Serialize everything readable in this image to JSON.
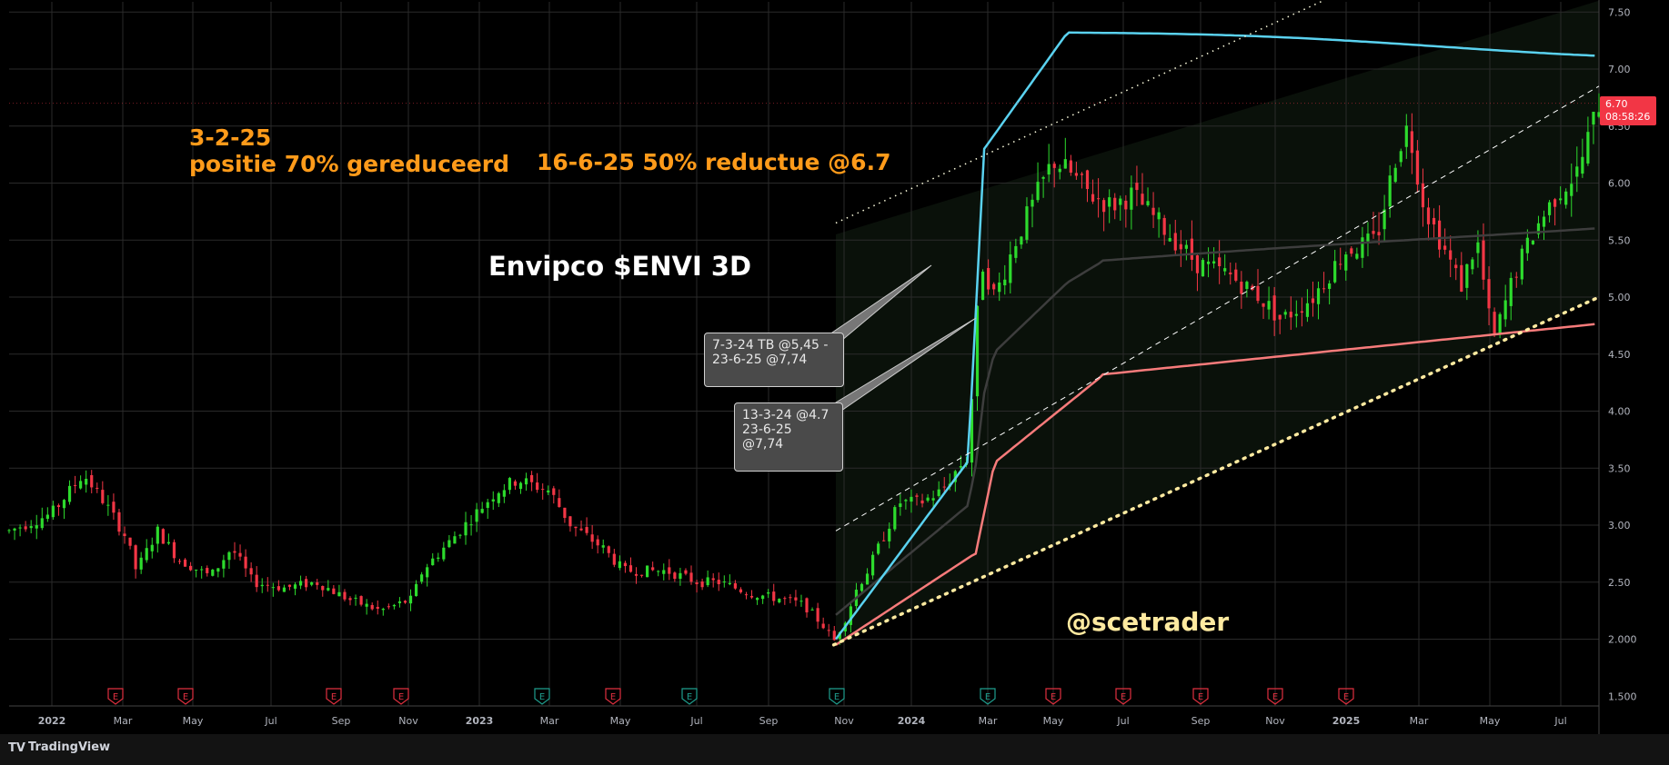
{
  "app": {
    "brand": "TradingView"
  },
  "annotations": {
    "note1_line1": "3-2-25",
    "note1_line2": "positie 70% gereduceerd",
    "note2": "16-6-25 50% reductue @6.7",
    "title": "Envipco $ENVI 3D",
    "watermark": "@scetrader",
    "callout1": "7-3-24 TB @5,45 -\n23-6-25 @7,74",
    "callout2": "13-3-24 @4.7\n23-6-25\n@7,74"
  },
  "price_tag": {
    "price": "6.70",
    "countdown": "08:58:26"
  },
  "colors": {
    "up": "#2ddb2d",
    "down": "#f23645",
    "upper_band": "#5ad2f0",
    "lower_band": "#f77b7b",
    "mid_band": "#3d3d3d",
    "channel_top": "#ffffe0",
    "channel_bottom": "#ffeaa0",
    "annotation": "#ff9b1a",
    "earnings_red": "#e0303f",
    "earnings_teal": "#1f9e8e"
  },
  "chart_data": {
    "type": "candlestick",
    "title": "Envipco $ENVI 3D",
    "ylim": [
      1.45,
      7.6
    ],
    "y_ticks": [
      "7.50",
      "7.00",
      "6.50",
      "6.00",
      "5.50",
      "5.00",
      "4.50",
      "4.00",
      "3.50",
      "3.00",
      "2.50",
      "2.000",
      "1.500"
    ],
    "x_ticks": [
      "2022",
      "Mar",
      "May",
      "Jul",
      "Sep",
      "Nov",
      "2023",
      "Mar",
      "May",
      "Jul",
      "Sep",
      "Nov",
      "2024",
      "Mar",
      "May",
      "Jul",
      "Sep",
      "Nov",
      "2025",
      "Mar",
      "May",
      "Jul"
    ],
    "y_gridlines": [
      2.0,
      2.5,
      3.0,
      3.5,
      4.0,
      4.5,
      5.0,
      5.5,
      6.0,
      6.5,
      7.0,
      7.5
    ],
    "price_path": [
      [
        0,
        2.95
      ],
      [
        0.04,
        3.1
      ],
      [
        0.07,
        3.45
      ],
      [
        0.09,
        3.2
      ],
      [
        0.11,
        2.9
      ],
      [
        0.12,
        2.6
      ],
      [
        0.14,
        2.95
      ],
      [
        0.16,
        2.7
      ],
      [
        0.19,
        2.55
      ],
      [
        0.21,
        2.8
      ],
      [
        0.23,
        2.5
      ],
      [
        0.26,
        2.45
      ],
      [
        0.29,
        2.5
      ],
      [
        0.32,
        2.35
      ],
      [
        0.35,
        2.25
      ],
      [
        0.38,
        2.35
      ],
      [
        0.39,
        2.6
      ],
      [
        0.43,
        3.0
      ],
      [
        0.46,
        3.3
      ],
      [
        0.48,
        3.4
      ],
      [
        0.51,
        3.3
      ],
      [
        0.53,
        3.0
      ],
      [
        0.56,
        2.8
      ],
      [
        0.58,
        2.6
      ],
      [
        0.62,
        2.6
      ],
      [
        0.65,
        2.5
      ],
      [
        0.67,
        2.5
      ],
      [
        0.7,
        2.4
      ],
      [
        0.73,
        2.35
      ],
      [
        0.75,
        2.3
      ],
      [
        0.77,
        2.1
      ],
      [
        0.778,
        1.98
      ],
      [
        0.79,
        2.2
      ],
      [
        0.8,
        2.45
      ],
      [
        0.81,
        2.6
      ],
      [
        0.825,
        2.9
      ],
      [
        0.84,
        3.2
      ],
      [
        0.86,
        3.2
      ],
      [
        0.88,
        3.3
      ],
      [
        0.895,
        3.5
      ],
      [
        0.905,
        3.6
      ],
      [
        0.912,
        4.7
      ],
      [
        0.918,
        5.3
      ],
      [
        0.93,
        5.0
      ],
      [
        0.95,
        5.5
      ],
      [
        0.97,
        5.9
      ],
      [
        0.985,
        6.2
      ],
      [
        1.0,
        6.1
      ],
      [
        1.02,
        5.9
      ],
      [
        1.04,
        5.8
      ],
      [
        1.06,
        5.9
      ],
      [
        1.09,
        5.6
      ],
      [
        1.12,
        5.3
      ],
      [
        1.15,
        5.2
      ],
      [
        1.18,
        5.0
      ],
      [
        1.2,
        4.8
      ],
      [
        1.23,
        5.0
      ],
      [
        1.26,
        5.4
      ],
      [
        1.29,
        5.5
      ],
      [
        1.31,
        6.3
      ],
      [
        1.32,
        6.5
      ],
      [
        1.335,
        5.8
      ],
      [
        1.35,
        5.5
      ],
      [
        1.37,
        5.1
      ],
      [
        1.385,
        5.5
      ],
      [
        1.4,
        4.6
      ],
      [
        1.42,
        5.2
      ],
      [
        1.44,
        5.6
      ],
      [
        1.46,
        5.9
      ],
      [
        1.48,
        6.1
      ],
      [
        1.5,
        6.7
      ]
    ],
    "earnings_markers": [
      {
        "x_index": 1,
        "style": "red"
      },
      {
        "x_index": 2,
        "style": "red"
      },
      {
        "x_index": 4,
        "style": "red"
      },
      {
        "x_index": 5,
        "style": "red"
      },
      {
        "x_index": 7,
        "style": "teal"
      },
      {
        "x_index": 8,
        "style": "red"
      },
      {
        "x_index": 9,
        "style": "teal"
      },
      {
        "x_index": 11,
        "style": "teal"
      },
      {
        "x_index": 13,
        "style": "teal"
      },
      {
        "x_index": 14,
        "style": "red"
      },
      {
        "x_index": 15,
        "style": "red"
      },
      {
        "x_index": 16,
        "style": "red"
      },
      {
        "x_index": 17,
        "style": "red"
      },
      {
        "x_index": 18,
        "style": "red"
      }
    ]
  }
}
